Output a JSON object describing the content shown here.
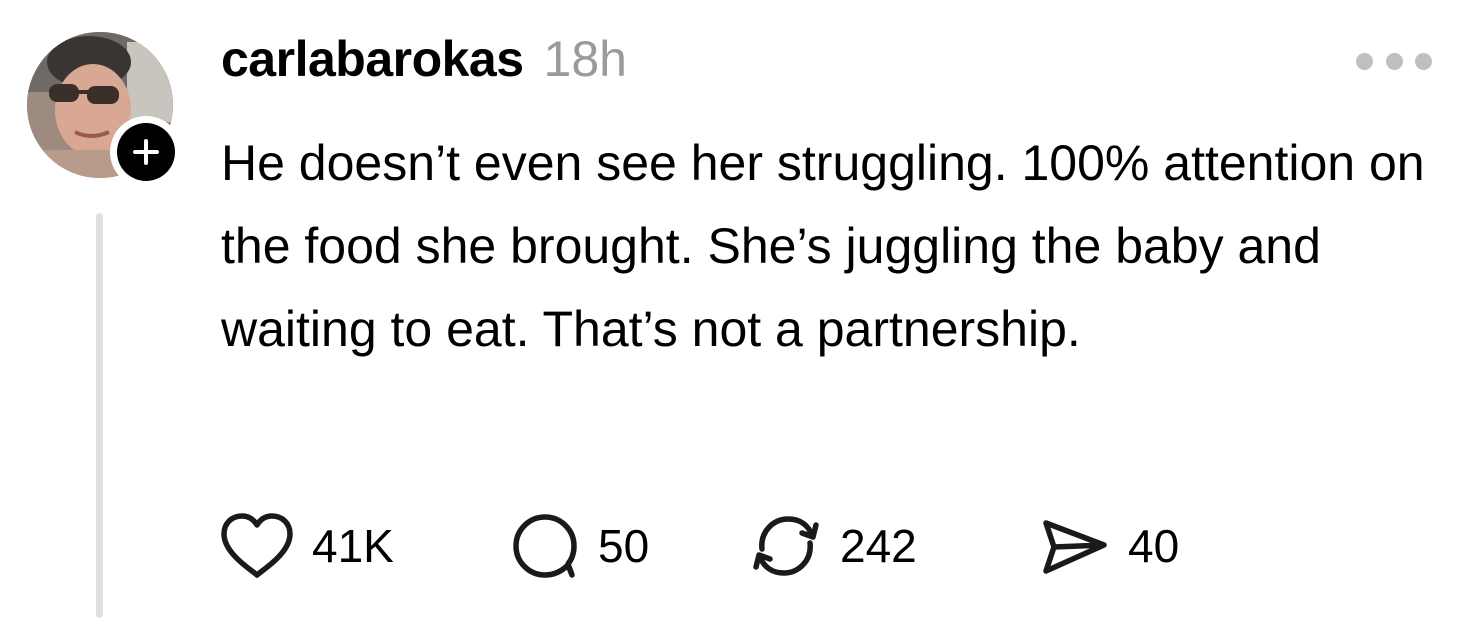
{
  "post": {
    "username": "carlabarokas",
    "timestamp": "18h",
    "text": "He doesn’t even see her struggling. 100% attention on the food she brought. She’s juggling the baby and waiting to eat. That’s not a partnership.",
    "avatar_icon": "profile-photo",
    "follow_icon": "plus-icon",
    "more_icon": "ellipsis-icon"
  },
  "actions": {
    "likes": {
      "icon": "heart-icon",
      "count": "41K"
    },
    "replies": {
      "icon": "comment-icon",
      "count": "50"
    },
    "reposts": {
      "icon": "repost-icon",
      "count": "242"
    },
    "shares": {
      "icon": "send-icon",
      "count": "40"
    }
  },
  "colors": {
    "text": "#000000",
    "muted": "#9a9a9a",
    "thread_line": "#e0e0e0",
    "more_dots": "#bfbfbf",
    "background": "#ffffff"
  }
}
